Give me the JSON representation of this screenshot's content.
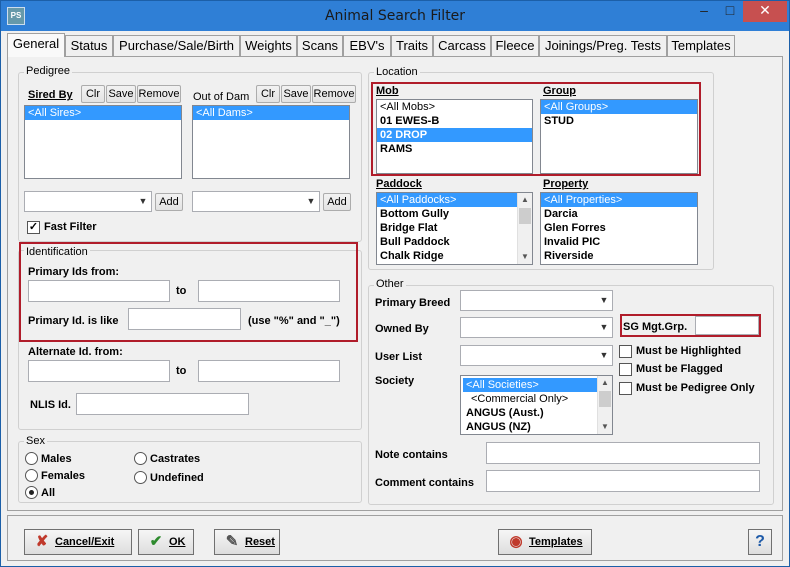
{
  "window": {
    "title": "Animal Search Filter",
    "app_icon": "PS",
    "min": "–",
    "max": "□",
    "close": "✕"
  },
  "tabs": [
    "General",
    "Status",
    "Purchase/Sale/Birth",
    "Weights",
    "Scans",
    "EBV's",
    "Traits",
    "Carcass",
    "Fleece",
    "Joinings/Preg. Tests",
    "Templates"
  ],
  "pedigree": {
    "title": "Pedigree",
    "sired_by": "Sired By",
    "out_of_dam": "Out of Dam",
    "clr": "Clr",
    "save": "Save",
    "remove": "Remove",
    "sires": [
      "<All Sires>"
    ],
    "dams": [
      "<All Dams>"
    ],
    "add": "Add",
    "fast_filter": "Fast Filter"
  },
  "identification": {
    "title": "Identification",
    "primary_from": "Primary Ids from:",
    "to": "to",
    "primary_like": "Primary Id. is like",
    "like_hint": "(use \"%\" and \"_\")",
    "alternate_from": "Alternate Id. from:",
    "nlis": "NLIS Id."
  },
  "sex": {
    "title": "Sex",
    "males": "Males",
    "castrates": "Castrates",
    "females": "Females",
    "undefined": "Undefined",
    "all": "All"
  },
  "location": {
    "title": "Location",
    "mob": "Mob",
    "mobs": [
      "<All Mobs>",
      "01 EWES-B",
      "02 DROP",
      "RAMS"
    ],
    "group": "Group",
    "groups": [
      "<All Groups>",
      "STUD"
    ],
    "paddock": "Paddock",
    "paddocks": [
      "<All Paddocks>",
      "Bottom Gully",
      "Bridge Flat",
      "Bull Paddock",
      "Chalk Ridge"
    ],
    "property": "Property",
    "properties": [
      "<All Properties>",
      "Darcia",
      "Glen Forres",
      "Invalid PIC",
      "Riverside"
    ]
  },
  "other": {
    "title": "Other",
    "primary_breed": "Primary Breed",
    "owned_by": "Owned By",
    "user_list": "User List",
    "society": "Society",
    "societies": [
      "<All Societies>",
      "<Commercial Only>",
      "ANGUS (Aust.)",
      "ANGUS (NZ)"
    ],
    "sg_mgt_grp": "SG Mgt.Grp.",
    "highlighted": "Must be Highlighted",
    "flagged": "Must be Flagged",
    "pedigree_only": "Must be Pedigree Only",
    "note_contains": "Note contains",
    "comment_contains": "Comment contains"
  },
  "buttons": {
    "cancel": "Cancel/Exit",
    "ok": "OK",
    "reset": "Reset",
    "templates": "Templates",
    "help": "?"
  }
}
